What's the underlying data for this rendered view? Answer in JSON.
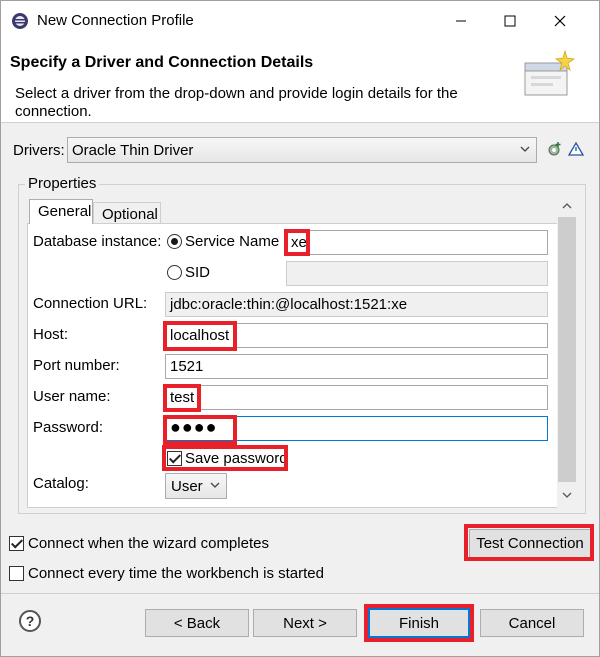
{
  "window": {
    "title": "New Connection Profile"
  },
  "banner": {
    "title": "Specify a Driver and Connection Details",
    "description": "Select a driver from the drop-down and provide login details for the connection."
  },
  "drivers": {
    "label": "Drivers:",
    "selected": "Oracle Thin Driver"
  },
  "properties": {
    "group_label": "Properties",
    "tabs": [
      {
        "label": "General",
        "selected": true
      },
      {
        "label": "Optional",
        "selected": false
      }
    ],
    "database_instance": {
      "label": "Database instance:",
      "service_name_label": "Service Name",
      "service_name_value": "xe",
      "sid_label": "SID",
      "sid_value": "",
      "selected_option": "Service Name"
    },
    "connection_url": {
      "label": "Connection URL:",
      "value": "jdbc:oracle:thin:@localhost:1521:xe"
    },
    "host": {
      "label": "Host:",
      "value": "localhost"
    },
    "port": {
      "label": "Port number:",
      "value": "1521"
    },
    "user_name": {
      "label": "User name:",
      "value": "test"
    },
    "password": {
      "label": "Password:",
      "value": "●●●●"
    },
    "save_password": {
      "label": "Save password",
      "checked": true
    },
    "catalog": {
      "label": "Catalog:",
      "selected": "User"
    }
  },
  "options": {
    "connect_when_completes": {
      "label": "Connect when the wizard completes",
      "checked": true
    },
    "connect_every_time": {
      "label": "Connect every time the workbench is started",
      "checked": false
    }
  },
  "buttons": {
    "test_connection": "Test Connection",
    "back": "< Back",
    "next": "Next >",
    "finish": "Finish",
    "cancel": "Cancel"
  },
  "colors": {
    "highlight": "#e8202a",
    "focus": "#0078d7"
  }
}
